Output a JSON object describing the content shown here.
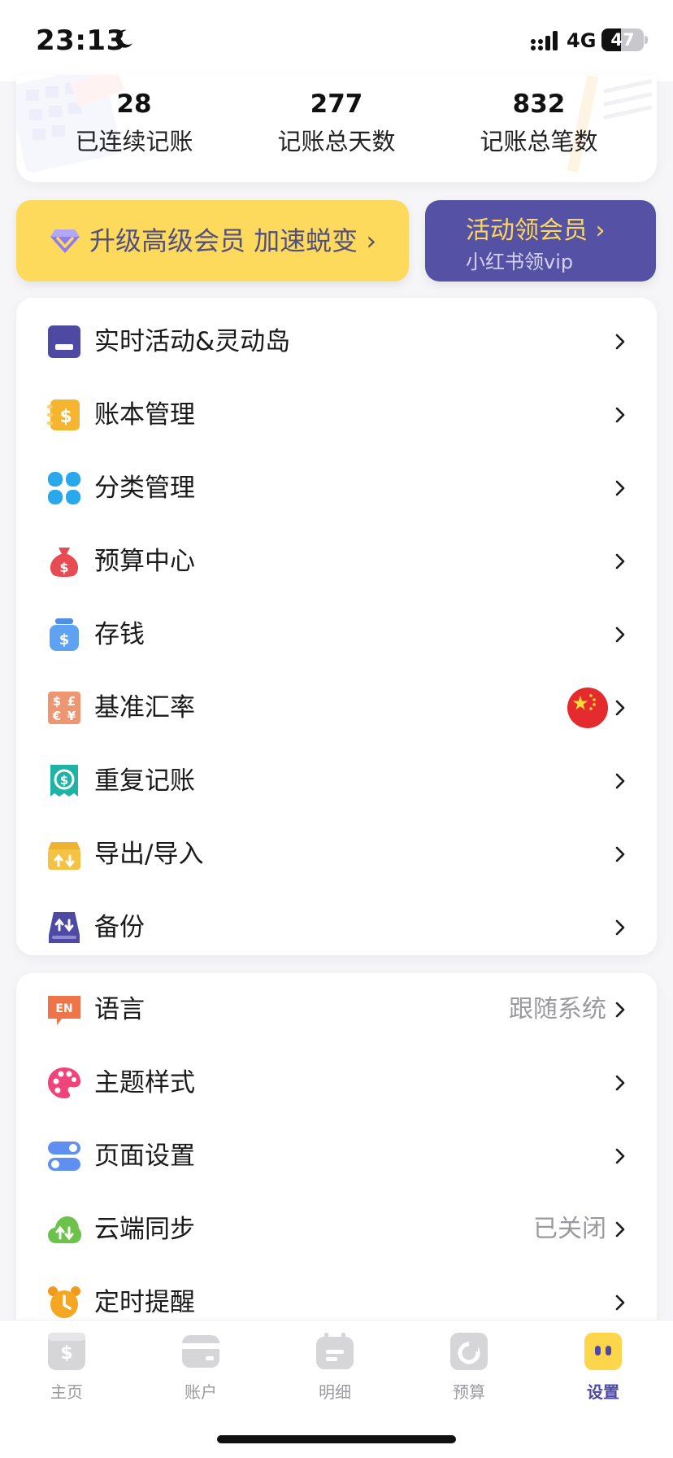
{
  "status_bar": {
    "time": "23:13",
    "network": "4G",
    "battery": "47",
    "battery_fraction": 0.47
  },
  "stats": [
    {
      "value": "28",
      "label": "已连续记账"
    },
    {
      "value": "277",
      "label": "记账总天数"
    },
    {
      "value": "832",
      "label": "记账总笔数"
    }
  ],
  "promo": {
    "upgrade_label": "升级高级会员 加速蜕变 ›",
    "activity_title": "活动领会员 ›",
    "activity_subtitle": "小红书领vip"
  },
  "menu_group_1": [
    {
      "label": "实时活动&灵动岛",
      "icon": "live-activity-icon"
    },
    {
      "label": "账本管理",
      "icon": "ledger-icon"
    },
    {
      "label": "分类管理",
      "icon": "category-icon"
    },
    {
      "label": "预算中心",
      "icon": "money-bag-icon"
    },
    {
      "label": "存钱",
      "icon": "savings-jar-icon"
    },
    {
      "label": "基准汇率",
      "icon": "currency-exchange-icon",
      "flag": "china-flag-icon"
    },
    {
      "label": "重复记账",
      "icon": "recurring-bill-icon"
    },
    {
      "label": "导出/导入",
      "icon": "export-import-icon"
    },
    {
      "label": "备份",
      "icon": "backup-icon"
    }
  ],
  "menu_group_2": [
    {
      "label": "语言",
      "value": "跟随系统",
      "icon": "language-icon"
    },
    {
      "label": "主题样式",
      "icon": "palette-icon"
    },
    {
      "label": "页面设置",
      "icon": "toggle-settings-icon"
    },
    {
      "label": "云端同步",
      "value": "已关闭",
      "icon": "cloud-sync-icon"
    },
    {
      "label": "定时提醒",
      "icon": "alarm-clock-icon"
    }
  ],
  "tabs": [
    {
      "label": "主页",
      "icon": "home-icon"
    },
    {
      "label": "账户",
      "icon": "wallet-icon"
    },
    {
      "label": "明细",
      "icon": "details-icon"
    },
    {
      "label": "预算",
      "icon": "budget-icon"
    },
    {
      "label": "设置",
      "icon": "settings-icon",
      "active": true
    }
  ],
  "colors": {
    "accent": "#5552a5",
    "promo_yellow": "#fdda5b",
    "promo_gold_text": "#fbd85c"
  }
}
